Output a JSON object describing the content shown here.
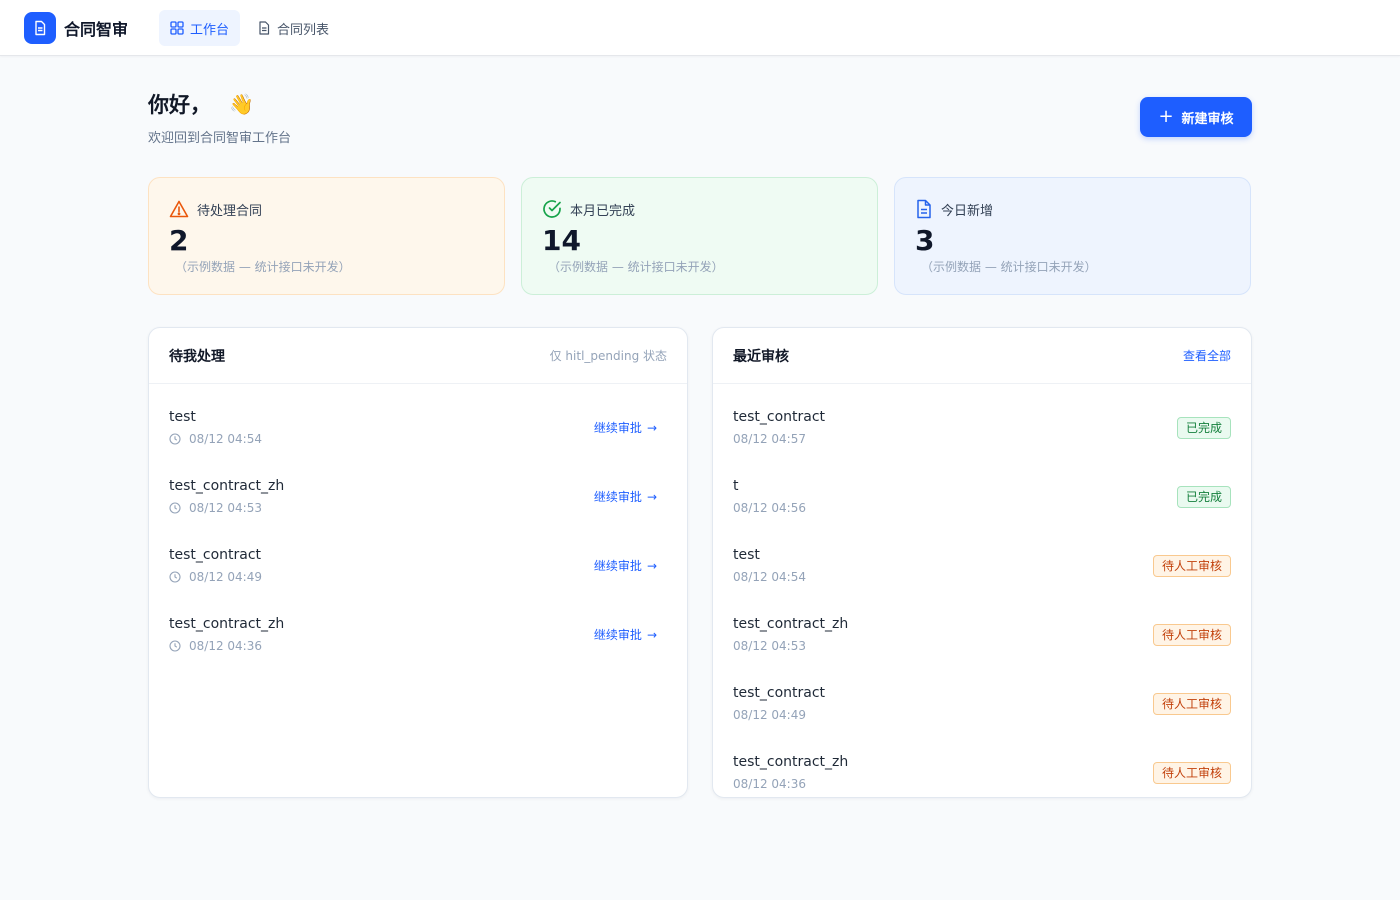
{
  "app": {
    "title": "合同智审"
  },
  "nav": {
    "tabs": [
      {
        "label": "工作台"
      },
      {
        "label": "合同列表"
      }
    ]
  },
  "header": {
    "greeting": "你好，",
    "subtitle": "欢迎回到合同智审工作台",
    "new_button": "新建审核"
  },
  "stats": [
    {
      "label": "待处理合同",
      "value": "2",
      "note": "（示例数据 — 统计接口未开发）"
    },
    {
      "label": "本月已完成",
      "value": "14",
      "note": "（示例数据 — 统计接口未开发）"
    },
    {
      "label": "今日新增",
      "value": "3",
      "note": "（示例数据 — 统计接口未开发）"
    }
  ],
  "pending_panel": {
    "title": "待我处理",
    "hint": "仅 hitl_pending 状态",
    "action_label": "继续审批",
    "items": [
      {
        "name": "test",
        "time": "08/12 04:54"
      },
      {
        "name": "test_contract_zh",
        "time": "08/12 04:53"
      },
      {
        "name": "test_contract",
        "time": "08/12 04:49"
      },
      {
        "name": "test_contract_zh",
        "time": "08/12 04:36"
      }
    ]
  },
  "recent_panel": {
    "title": "最近审核",
    "link": "查看全部",
    "items": [
      {
        "name": "test_contract",
        "time": "08/12 04:57",
        "status": "已完成"
      },
      {
        "name": "t",
        "time": "08/12 04:56",
        "status": "已完成"
      },
      {
        "name": "test",
        "time": "08/12 04:54",
        "status": "待人工审核"
      },
      {
        "name": "test_contract_zh",
        "time": "08/12 04:53",
        "status": "待人工审核"
      },
      {
        "name": "test_contract",
        "time": "08/12 04:49",
        "status": "待人工审核"
      },
      {
        "name": "test_contract_zh",
        "time": "08/12 04:36",
        "status": "待人工审核"
      }
    ]
  },
  "colors": {
    "primary": "#1e5eff",
    "done": "#15803d",
    "pending": "#c2410c"
  }
}
